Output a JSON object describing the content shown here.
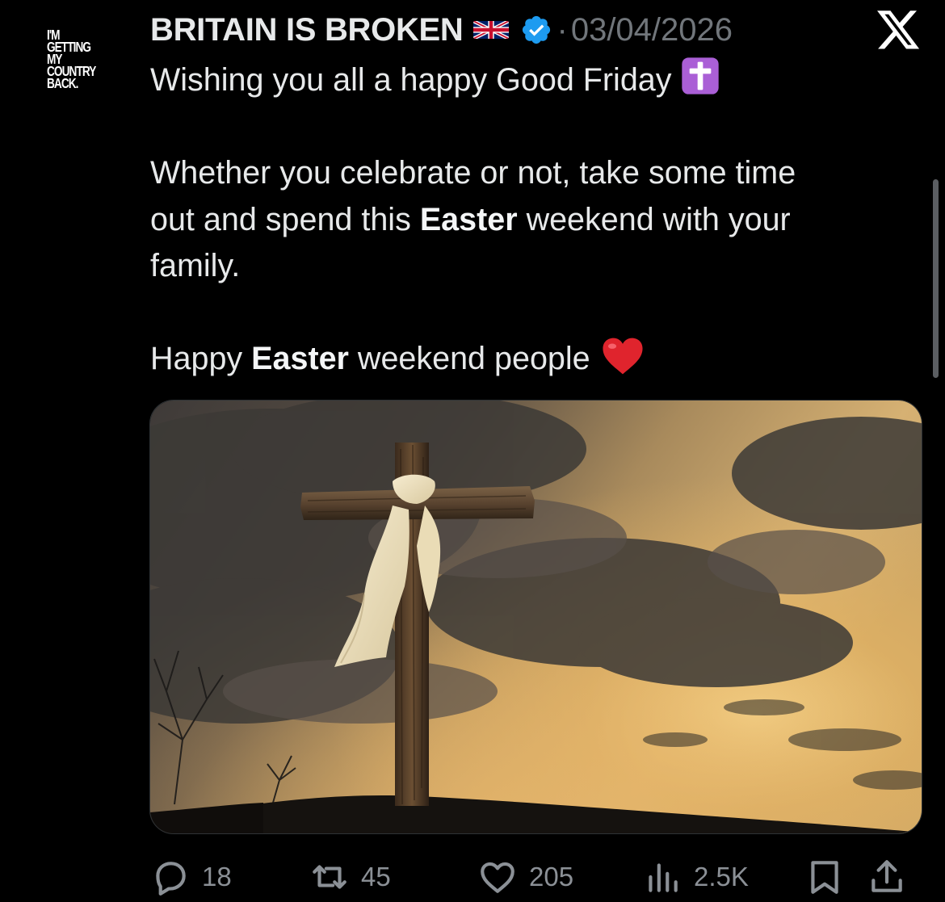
{
  "avatar": {
    "lines": [
      "I'M",
      "GETTING",
      "MY",
      "COUNTRY",
      "BACK."
    ]
  },
  "header": {
    "display_name": "BRITAIN IS BROKEN",
    "separator": "·",
    "date": "03/04/2026",
    "flag_icon": "uk-flag-icon",
    "verified_icon": "verified-badge-icon",
    "brand_icon": "x-logo-icon"
  },
  "tweet": {
    "line1": "Wishing you all a happy Good Friday",
    "para2_a": "Whether you celebrate or not, take some time",
    "para2_b_pre": "out and spend this ",
    "para2_b_bold": "Easter",
    "para2_b_post": " weekend with your",
    "para2_c": "family.",
    "para3_pre": "Happy ",
    "para3_bold": "Easter",
    "para3_post": " weekend people",
    "emoji_1": "latin-cross-emoji",
    "emoji_2": "red-heart-emoji"
  },
  "media": {
    "icon": "photo-cross-at-sunset"
  },
  "actions": {
    "replies": "18",
    "reposts": "45",
    "likes": "205",
    "views": "2.5K"
  },
  "colors": {
    "background": "#000000",
    "text": "#e7e9ea",
    "muted": "#71767b",
    "verified": "#1d9bf0",
    "emoji_purple": "#9b59d0",
    "heart_red": "#e0242d"
  }
}
